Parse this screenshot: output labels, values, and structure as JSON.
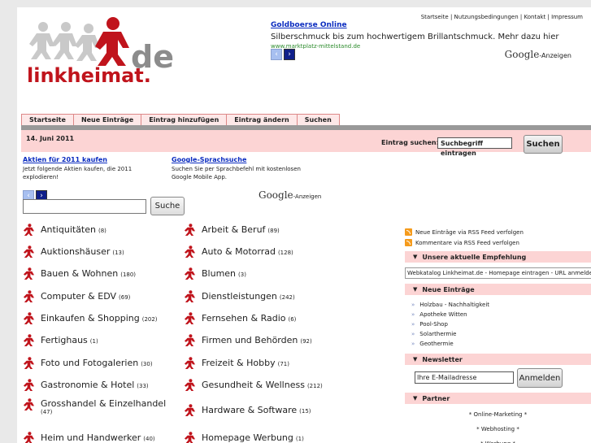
{
  "header": {
    "logo_text": "linkheimat.de",
    "top_links": "Startseite | Nutzungsbedingungen | Kontakt | Impressum",
    "ad": {
      "title": "Goldboerse Online",
      "text": "Silberschmuck bis zum hochwertigem Brillantschmuck. Mehr dazu hier",
      "url": "www.marktplatz-mittelstand.de",
      "google_label": "Google",
      "anzeigen": "-Anzeigen"
    }
  },
  "nav": {
    "tabs": [
      "Startseite",
      "Neue Einträge",
      "Eintrag hinzufügen",
      "Eintrag ändern",
      "Suchen"
    ]
  },
  "datebar": {
    "date": "14. Juni 2011",
    "search_label": "Eintrag suchen:",
    "search_value": "Suchbegriff eintragen",
    "search_button": "Suchen"
  },
  "ads2": {
    "items": [
      {
        "title": "Aktien für 2011 kaufen",
        "text": "Jetzt folgende Aktien kaufen, die 2011 explodieren!"
      },
      {
        "title": "Google-Sprachsuche",
        "text": "Suchen Sie per Sprachbefehl mit kostenlosen Google Mobile App."
      }
    ],
    "google_label": "Google",
    "anzeigen": "-Anzeigen"
  },
  "main_search": {
    "button": "Suche",
    "value": ""
  },
  "categories": [
    {
      "name": "Antiquitäten",
      "count": "(8)"
    },
    {
      "name": "Arbeit & Beruf",
      "count": "(89)"
    },
    {
      "name": "Auktionshäuser",
      "count": "(13)"
    },
    {
      "name": "Auto & Motorrad",
      "count": "(128)"
    },
    {
      "name": "Bauen & Wohnen",
      "count": "(180)"
    },
    {
      "name": "Blumen",
      "count": "(3)"
    },
    {
      "name": "Computer & EDV",
      "count": "(69)"
    },
    {
      "name": "Dienstleistungen",
      "count": "(242)"
    },
    {
      "name": "Einkaufen & Shopping",
      "count": "(202)"
    },
    {
      "name": "Fernsehen & Radio",
      "count": "(6)"
    },
    {
      "name": "Fertighaus",
      "count": "(1)"
    },
    {
      "name": "Firmen und Behörden",
      "count": "(92)"
    },
    {
      "name": "Foto und Fotogalerien",
      "count": "(30)"
    },
    {
      "name": "Freizeit & Hobby",
      "count": "(71)"
    },
    {
      "name": "Gastronomie & Hotel",
      "count": "(33)"
    },
    {
      "name": "Gesundheit & Wellness",
      "count": "(212)"
    },
    {
      "name": "Grosshandel & Einzelhandel",
      "count": "(47)"
    },
    {
      "name": "Hardware & Software",
      "count": "(15)"
    },
    {
      "name": "Heim und Handwerker",
      "count": "(40)"
    },
    {
      "name": "Homepage Werbung",
      "count": "(1)"
    }
  ],
  "sidebar": {
    "rss1": "Neue Einträge via RSS Feed verfolgen",
    "rss2": "Kommentare via RSS Feed verfolgen",
    "empfehlung_title": "Unsere aktuelle Empfehlung",
    "empfehlung_text": "Webkatalog Linkheimat.de - Homepage eintragen - URL anmelden",
    "neue_title": "Neue Einträge",
    "neue_items": [
      "Holzbau - Nachhaltigkeit",
      "Apotheke Witten",
      "Pool-Shop",
      "Solarthermie",
      "Geothermie"
    ],
    "newsletter_title": "Newsletter",
    "newsletter_placeholder": "Ihre E-Mailadresse",
    "newsletter_button": "Anmelden",
    "partner_title": "Partner",
    "partner_items": [
      "* Online-Marketing *",
      "* Webhosting *",
      "* Werbung *"
    ]
  },
  "colors": {
    "accent_pink": "#fcd4d4",
    "link_blue": "#0b2cc0",
    "icon_red": "#c0141c"
  }
}
